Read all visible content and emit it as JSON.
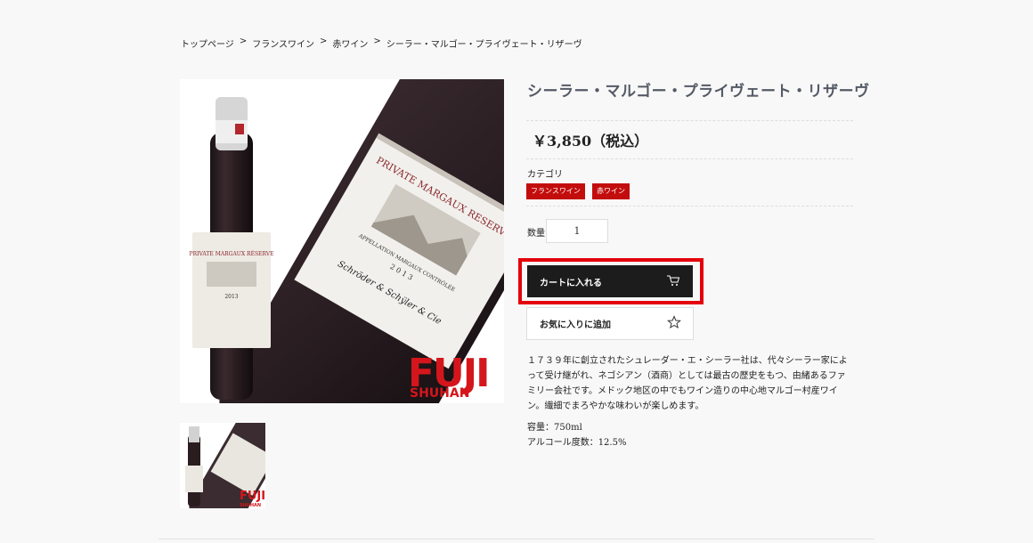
{
  "breadcrumb": [
    {
      "label": "トップページ"
    },
    {
      "label": "フランスワイン"
    },
    {
      "label": "赤ワイン"
    },
    {
      "label": "シーラー・マルゴー・プライヴェート・リザーヴ"
    }
  ],
  "breadcrumb_sep": ">",
  "product": {
    "title": "シーラー・マルゴー・プライヴェート・リザーヴ",
    "price": "￥3,850（税込）",
    "category_label": "カテゴリ",
    "categories": [
      "フランスワイン",
      "赤ワイン"
    ],
    "quantity_label": "数量",
    "quantity_value": "1",
    "cart_label": "カートに入れる",
    "favorite_label": "お気に入りに追加",
    "description": "１７３９年に創立されたシュレーダー・エ・シーラー社は、代々シーラー家によって受け継がれ、ネゴシアン（酒商）としては最古の歴史をもつ、由緒あるファミリー会社です。メドック地区の中でもワイン造りの中心地マルゴー村産ワイン。繊細でまろやかな味わいが楽しめます。",
    "specs": [
      "容量：750ml",
      "アルコール度数：12.5%"
    ]
  },
  "image": {
    "label_line1": "PRIVATE MARGAUX RESERVE",
    "label_line2": "APPELLATION MARGAUX CONTRÔLÉE",
    "vintage": "2 0 1 3",
    "signature": "Schröder & Schÿler & Cie",
    "small_label": "PRIVATE MARGAUX RÉSERVE",
    "small_vintage": "2013",
    "logo_top": "FUJI",
    "logo_bottom": "SHUHAN"
  },
  "colors": {
    "accent": "#c30d0d",
    "highlight": "#e3000b",
    "button_dark": "#1c1c1c",
    "title": "#555a66"
  },
  "icons": {
    "cart": "cart-icon",
    "favorite": "star-icon"
  }
}
